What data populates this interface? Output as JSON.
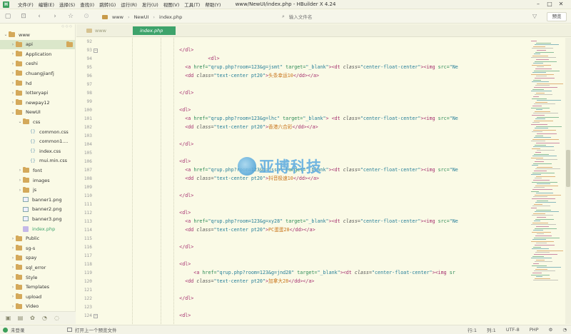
{
  "app": {
    "logo_text": "H",
    "title": "www/NewUI/index.php - HBuilder X 4.24",
    "menu": [
      "文件(F)",
      "编辑(E)",
      "选择(S)",
      "查找(I)",
      "跳转(G)",
      "运行(R)",
      "发行(U)",
      "视图(V)",
      "工具(T)",
      "帮助(Y)"
    ],
    "win_controls": {
      "minimize": "–",
      "maximize": "□",
      "close": "✕"
    }
  },
  "toolbar": {
    "breadcrumb": [
      "www",
      "NewUI",
      "index.php"
    ],
    "file_search_placeholder": "输入文件名",
    "preview_label": "预览"
  },
  "sidebar": {
    "items": [
      {
        "label": "www",
        "kind": "folder",
        "depth": 0,
        "expanded": true
      },
      {
        "label": "api",
        "kind": "folder",
        "depth": 1,
        "expanded": false,
        "selected": true
      },
      {
        "label": "Application",
        "kind": "folder",
        "depth": 1,
        "expanded": false
      },
      {
        "label": "ceshi",
        "kind": "folder",
        "depth": 1,
        "expanded": false
      },
      {
        "label": "chuangjianfj",
        "kind": "folder",
        "depth": 1,
        "expanded": false
      },
      {
        "label": "hd",
        "kind": "folder",
        "depth": 1,
        "expanded": false
      },
      {
        "label": "lotteryapi",
        "kind": "folder",
        "depth": 1,
        "expanded": false
      },
      {
        "label": "newpay12",
        "kind": "folder",
        "depth": 1,
        "expanded": false
      },
      {
        "label": "NewUI",
        "kind": "folder",
        "depth": 1,
        "expanded": true
      },
      {
        "label": "css",
        "kind": "folder",
        "depth": 2,
        "expanded": true
      },
      {
        "label": "common.css",
        "kind": "css",
        "depth": 3
      },
      {
        "label": "common1....",
        "kind": "css",
        "depth": 3
      },
      {
        "label": "index.css",
        "kind": "css",
        "depth": 3
      },
      {
        "label": "mui.min.css",
        "kind": "css",
        "depth": 3
      },
      {
        "label": "font",
        "kind": "folder",
        "depth": 2,
        "expanded": false
      },
      {
        "label": "images",
        "kind": "folder",
        "depth": 2,
        "expanded": false
      },
      {
        "label": "js",
        "kind": "folder",
        "depth": 2,
        "expanded": false
      },
      {
        "label": "banner1.png",
        "kind": "image",
        "depth": 2
      },
      {
        "label": "banner2.png",
        "kind": "image",
        "depth": 2
      },
      {
        "label": "banner3.png",
        "kind": "image",
        "depth": 2
      },
      {
        "label": "index.php",
        "kind": "php",
        "depth": 2,
        "active": true
      },
      {
        "label": "Public",
        "kind": "folder",
        "depth": 1,
        "expanded": false
      },
      {
        "label": "sg-s",
        "kind": "folder",
        "depth": 1,
        "expanded": false
      },
      {
        "label": "spay",
        "kind": "folder",
        "depth": 1,
        "expanded": false
      },
      {
        "label": "sql_error",
        "kind": "folder",
        "depth": 1,
        "expanded": false
      },
      {
        "label": "Style",
        "kind": "folder",
        "depth": 1,
        "expanded": false
      },
      {
        "label": "Templates",
        "kind": "folder",
        "depth": 1,
        "expanded": false
      },
      {
        "label": "upload",
        "kind": "folder",
        "depth": 1,
        "expanded": false
      },
      {
        "label": "Video",
        "kind": "folder",
        "depth": 1,
        "expanded": false
      }
    ]
  },
  "tabs": [
    {
      "label": "www",
      "active": false
    },
    {
      "label": "index.php",
      "active": true
    }
  ],
  "editor": {
    "lines": [
      {
        "n": "92",
        "fold": false,
        "parts": []
      },
      {
        "n": "93",
        "fold": true,
        "parts": [
          [
            "pl",
            "      "
          ],
          [
            "tg",
            "</dl>"
          ]
        ]
      },
      {
        "n": "94",
        "fold": false,
        "parts": [
          [
            "pl",
            "                "
          ],
          [
            "tg",
            "<dl>"
          ]
        ]
      },
      {
        "n": "95",
        "fold": false,
        "parts": [
          [
            "pl",
            "        "
          ],
          [
            "tg",
            "<a "
          ],
          [
            "at",
            "href="
          ],
          [
            "st",
            "\"qrup.php?room=123&g=jsmt\""
          ],
          [
            "at",
            " target="
          ],
          [
            "st",
            "\"_blank\""
          ],
          [
            "tg",
            ">"
          ],
          [
            "tg",
            "<dt "
          ],
          [
            "cls",
            "class="
          ],
          [
            "st",
            "\"center-float-center\""
          ],
          [
            "tg",
            ">"
          ],
          [
            "tg",
            "<img "
          ],
          [
            "at",
            "src="
          ],
          [
            "st",
            "\"Ne"
          ]
        ]
      },
      {
        "n": "96",
        "fold": false,
        "parts": [
          [
            "pl",
            "        "
          ],
          [
            "tg",
            "<dd "
          ],
          [
            "cls",
            "class="
          ],
          [
            "st",
            "\"text-center pt20\""
          ],
          [
            "tg",
            ">"
          ],
          [
            "txt",
            "头条幸运10"
          ],
          [
            "tg",
            "</dd></a>"
          ]
        ]
      },
      {
        "n": "97",
        "fold": false,
        "parts": []
      },
      {
        "n": "98",
        "fold": false,
        "parts": [
          [
            "pl",
            "      "
          ],
          [
            "tg",
            "</dl>"
          ]
        ]
      },
      {
        "n": "99",
        "fold": false,
        "parts": []
      },
      {
        "n": "100",
        "fold": false,
        "parts": [
          [
            "pl",
            "      "
          ],
          [
            "tg",
            "<dl>"
          ]
        ]
      },
      {
        "n": "101",
        "fold": false,
        "parts": [
          [
            "pl",
            "        "
          ],
          [
            "tg",
            "<a "
          ],
          [
            "at",
            "href="
          ],
          [
            "st",
            "\"qrup.php?room=123&g=lhc\""
          ],
          [
            "at",
            " target="
          ],
          [
            "st",
            "\"_blank\""
          ],
          [
            "tg",
            "> "
          ],
          [
            "tg",
            "<dt "
          ],
          [
            "cls",
            "class="
          ],
          [
            "st",
            "\"center-float-center\""
          ],
          [
            "tg",
            ">"
          ],
          [
            "tg",
            "<img "
          ],
          [
            "at",
            "src="
          ],
          [
            "st",
            "\"Ne"
          ]
        ]
      },
      {
        "n": "102",
        "fold": false,
        "parts": [
          [
            "pl",
            "        "
          ],
          [
            "tg",
            "<dd "
          ],
          [
            "cls",
            "class="
          ],
          [
            "st",
            "\"text-center pt20\""
          ],
          [
            "tg",
            ">"
          ],
          [
            "txt",
            "香港六合彩"
          ],
          [
            "tg",
            "</dd></a>"
          ]
        ]
      },
      {
        "n": "103",
        "fold": false,
        "parts": []
      },
      {
        "n": "104",
        "fold": false,
        "parts": [
          [
            "pl",
            "      "
          ],
          [
            "tg",
            "</dl>"
          ]
        ]
      },
      {
        "n": "105",
        "fold": false,
        "parts": []
      },
      {
        "n": "106",
        "fold": false,
        "parts": [
          [
            "pl",
            "      "
          ],
          [
            "tg",
            "<dl>"
          ]
        ]
      },
      {
        "n": "107",
        "fold": false,
        "parts": [
          [
            "pl",
            "        "
          ],
          [
            "tg",
            "<a "
          ],
          [
            "at",
            "href="
          ],
          [
            "st",
            "\"qrup.php?room=123&g=jssm\""
          ],
          [
            "at",
            " target="
          ],
          [
            "st",
            "\"_blank\""
          ],
          [
            "tg",
            ">"
          ],
          [
            "tg",
            "<dt "
          ],
          [
            "cls",
            "class="
          ],
          [
            "st",
            "\"center-float-center\""
          ],
          [
            "tg",
            ">"
          ],
          [
            "tg",
            "<img "
          ],
          [
            "at",
            "src="
          ],
          [
            "st",
            "\"Ne"
          ]
        ]
      },
      {
        "n": "108",
        "fold": false,
        "parts": [
          [
            "pl",
            "        "
          ],
          [
            "tg",
            "<dd "
          ],
          [
            "cls",
            "class="
          ],
          [
            "st",
            "\"text-center pt20\""
          ],
          [
            "tg",
            ">"
          ],
          [
            "txt",
            "抖音极速10"
          ],
          [
            "tg",
            "</dd></a>"
          ]
        ]
      },
      {
        "n": "109",
        "fold": false,
        "parts": []
      },
      {
        "n": "110",
        "fold": false,
        "parts": [
          [
            "pl",
            "      "
          ],
          [
            "tg",
            "</dl>"
          ]
        ]
      },
      {
        "n": "111",
        "fold": false,
        "parts": []
      },
      {
        "n": "112",
        "fold": false,
        "parts": [
          [
            "pl",
            "      "
          ],
          [
            "tg",
            "<dl>"
          ]
        ]
      },
      {
        "n": "113",
        "fold": false,
        "parts": [
          [
            "pl",
            "        "
          ],
          [
            "tg",
            "<a "
          ],
          [
            "at",
            "href="
          ],
          [
            "st",
            "\"qrup.php?room=123&g=xy28\""
          ],
          [
            "at",
            " target="
          ],
          [
            "st",
            "\"_blank\""
          ],
          [
            "tg",
            ">"
          ],
          [
            "tg",
            "<dt "
          ],
          [
            "cls",
            "class="
          ],
          [
            "st",
            "\"center-float-center\""
          ],
          [
            "tg",
            ">"
          ],
          [
            "tg",
            "<img "
          ],
          [
            "at",
            "src="
          ],
          [
            "st",
            "\"Ne"
          ]
        ]
      },
      {
        "n": "114",
        "fold": false,
        "parts": [
          [
            "pl",
            "        "
          ],
          [
            "tg",
            "<dd "
          ],
          [
            "cls",
            "class="
          ],
          [
            "st",
            "\"text-center pt20\""
          ],
          [
            "tg",
            ">"
          ],
          [
            "txt",
            "PC蛋蛋28"
          ],
          [
            "tg",
            "</dd></a>"
          ]
        ]
      },
      {
        "n": "115",
        "fold": false,
        "parts": []
      },
      {
        "n": "116",
        "fold": false,
        "parts": [
          [
            "pl",
            "      "
          ],
          [
            "tg",
            "</dl>"
          ]
        ]
      },
      {
        "n": "117",
        "fold": false,
        "parts": []
      },
      {
        "n": "118",
        "fold": false,
        "parts": [
          [
            "pl",
            "      "
          ],
          [
            "tg",
            "<dl>"
          ]
        ]
      },
      {
        "n": "119",
        "fold": false,
        "parts": [
          [
            "pl",
            "           "
          ],
          [
            "tg",
            "<a "
          ],
          [
            "at",
            "href="
          ],
          [
            "st",
            "\"qrup.php?room=123&g=jnd28\""
          ],
          [
            "at",
            " target="
          ],
          [
            "st",
            "\"_blank\""
          ],
          [
            "tg",
            ">"
          ],
          [
            "tg",
            "<dt "
          ],
          [
            "cls",
            "class="
          ],
          [
            "st",
            "\"center-float-center\""
          ],
          [
            "tg",
            ">"
          ],
          [
            "tg",
            "<img "
          ],
          [
            "at",
            "sr"
          ]
        ]
      },
      {
        "n": "120",
        "fold": false,
        "parts": [
          [
            "pl",
            "        "
          ],
          [
            "tg",
            "<dd "
          ],
          [
            "cls",
            "class="
          ],
          [
            "st",
            "\"text-center pt20\""
          ],
          [
            "tg",
            ">"
          ],
          [
            "txt",
            "加拿大28"
          ],
          [
            "tg",
            "</dd></a>"
          ]
        ]
      },
      {
        "n": "121",
        "fold": false,
        "parts": []
      },
      {
        "n": "122",
        "fold": false,
        "parts": [
          [
            "pl",
            "      "
          ],
          [
            "tg",
            "</dl>"
          ]
        ]
      },
      {
        "n": "123",
        "fold": false,
        "parts": []
      },
      {
        "n": "124",
        "fold": true,
        "parts": [
          [
            "pl",
            "      "
          ],
          [
            "tg",
            "<dl>"
          ]
        ]
      }
    ]
  },
  "watermark": {
    "text": "亚博科技"
  },
  "status": {
    "user": "未登录",
    "open_previous": "打开上一个预览文件",
    "line": "行:1",
    "col": "列:1",
    "encoding": "UTF-8",
    "language": "PHP"
  },
  "colors": {
    "accent": "#3ea36b",
    "background": "#fafae6",
    "tag": "#a52f6e",
    "string": "#267f99",
    "text": "#c9751d"
  }
}
